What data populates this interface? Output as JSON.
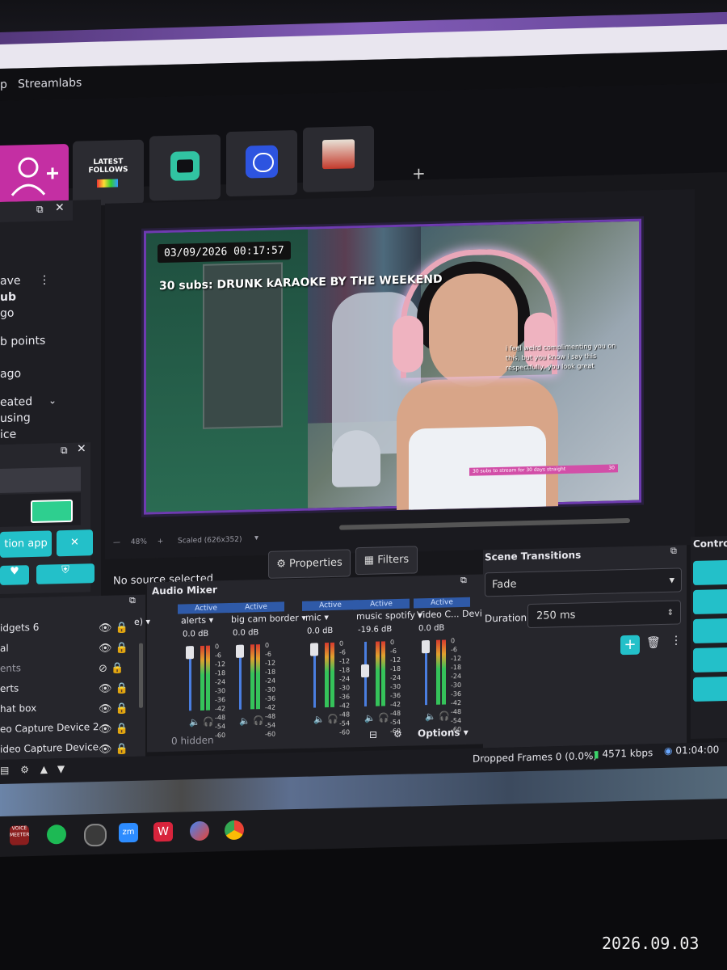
{
  "menu": {
    "partial_item": "p",
    "app_name": "Streamlabs"
  },
  "topbar": {
    "latest_follows_label": "LATEST FOLLOWS",
    "add_tab_symbol": "+"
  },
  "left_panel": {
    "events": [
      "ave",
      "ub",
      "go",
      "b points",
      "ago",
      "eated",
      "using",
      "ice"
    ],
    "buttons": {
      "action_app": "tion app"
    }
  },
  "preview": {
    "overlay_date": "03/09/2026 00:17:57",
    "overlay_goal": "30 subs: DRUNK kARAOKE BY THE WEEKEND",
    "chat_message": "i feel weird complimenting you on this, but you know i say this respectfully, you look great",
    "sub_goal_bar": "30 subs to stream for 30 days straight",
    "sub_goal_bar_right": "30",
    "zoom": "48%",
    "scaled": "Scaled (626x352)"
  },
  "source_toolbar": {
    "no_source": "No source selected",
    "properties": "Properties",
    "filters": "Filters"
  },
  "sources": {
    "items": [
      "idgets 6",
      "al",
      "ents",
      "erts",
      "hat box",
      "eo Capture Device 2",
      "ideo Capture Device"
    ]
  },
  "audio_mixer": {
    "title": "Audio Mixer",
    "active_label": "Active",
    "channels": [
      {
        "name": "e)",
        "db": ""
      },
      {
        "name": "alerts",
        "db": "0.0 dB"
      },
      {
        "name": "big cam border",
        "db": "0.0 dB"
      },
      {
        "name": "mic",
        "db": "0.0 dB"
      },
      {
        "name": "music spotify",
        "db": "-19.6 dB"
      },
      {
        "name": "Video C... Devi",
        "db": "0.0 dB"
      }
    ],
    "ticks": [
      "0",
      "-6",
      "-12",
      "-18",
      "-24",
      "-30",
      "-36",
      "-42",
      "-48",
      "-54",
      "-60"
    ],
    "hidden": "0 hidden",
    "options": "Options"
  },
  "scene_transitions": {
    "title": "Scene Transitions",
    "transition": "Fade",
    "duration_label": "Duration",
    "duration_value": "250 ms"
  },
  "controls": {
    "title": "Contro"
  },
  "status": {
    "dropped_frames": "Dropped Frames 0 (0.0%)",
    "bitrate": "4571 kbps",
    "uptime": "01:04:00"
  },
  "taskbar": {
    "voicemeeter": "VOICE MEETER",
    "zoom": "zm"
  },
  "photo_timestamp": "2026.09.03",
  "colors": {
    "accent_pink": "#c42fa3",
    "teal": "#23c0c9",
    "active_blue": "#2f5aa8",
    "panel_bg": "#26262c"
  }
}
